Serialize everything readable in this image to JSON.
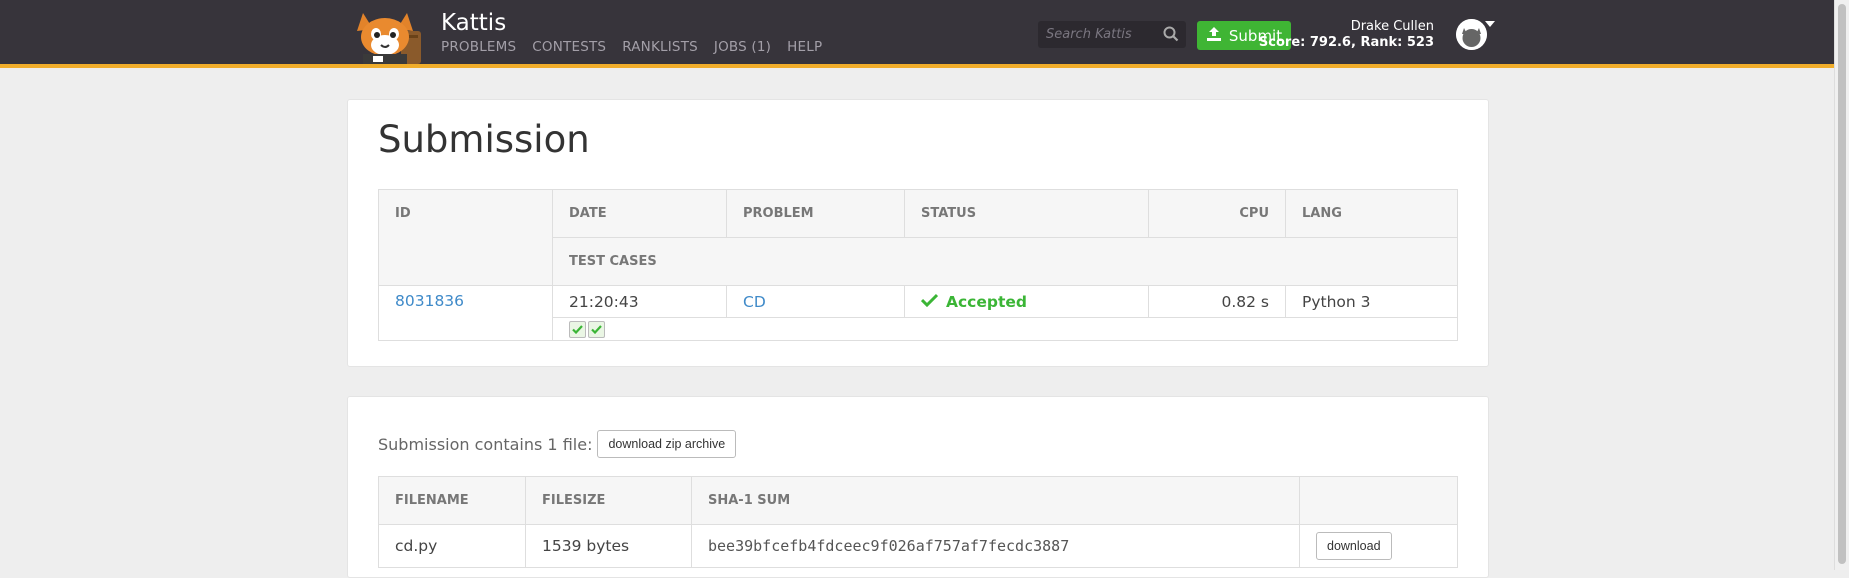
{
  "brand": {
    "name": "Kattis"
  },
  "nav": [
    "PROBLEMS",
    "CONTESTS",
    "RANKLISTS",
    "JOBS (1)",
    "HELP"
  ],
  "search": {
    "placeholder": "Search Kattis"
  },
  "submit_label": "Submit",
  "user": {
    "name": "Drake Cullen",
    "score_rank": "Score: 792.6, Rank: 523"
  },
  "submission": {
    "title": "Submission",
    "headers": [
      "ID",
      "DATE",
      "PROBLEM",
      "STATUS",
      "CPU",
      "LANG"
    ],
    "test_cases_header": "TEST CASES",
    "row": {
      "id": "8031836",
      "date": "21:20:43",
      "problem": "CD",
      "status": "Accepted",
      "cpu": "0.82 s",
      "lang": "Python 3"
    },
    "test_cases": [
      "passed",
      "passed"
    ]
  },
  "files": {
    "contains_text": "Submission contains 1 file:",
    "zip_button": "download zip archive",
    "headers": [
      "FILENAME",
      "FILESIZE",
      "SHA-1 SUM",
      ""
    ],
    "rows": [
      {
        "filename": "cd.py",
        "filesize": "1539 bytes",
        "sha1": "bee39bfcefb4fdceec9f026af757af7fecdc3887",
        "download": "download"
      }
    ]
  },
  "colors": {
    "topbar": "#37343b",
    "accent": "#f0ad2b",
    "submit": "#3fb534",
    "link": "#3f8ac9",
    "accepted": "#3bb536"
  }
}
